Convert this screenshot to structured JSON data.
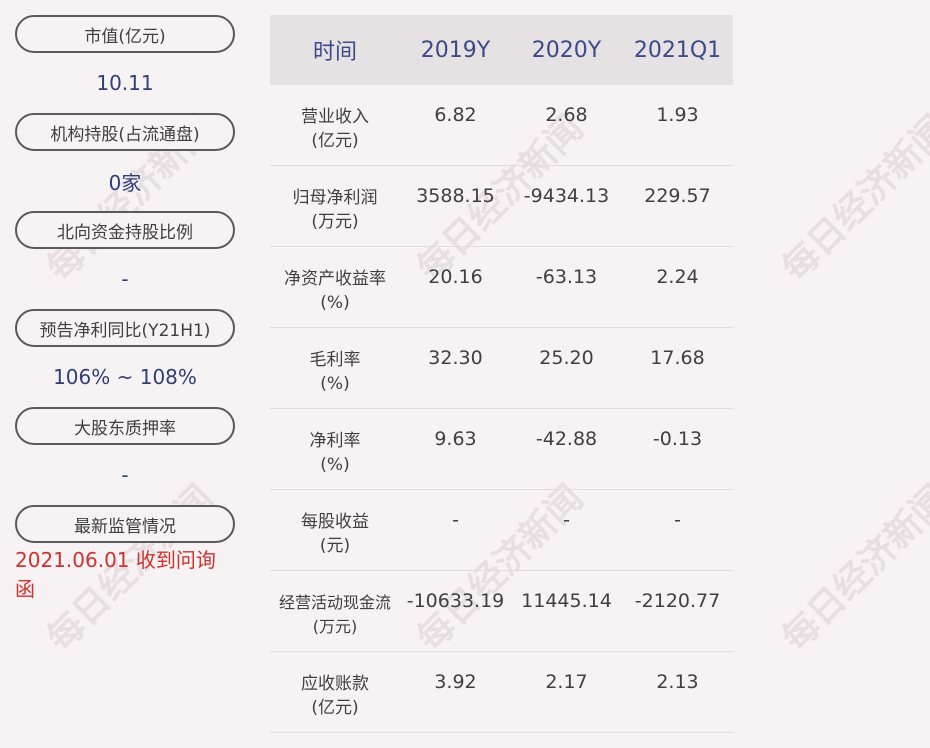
{
  "left": [
    {
      "label": "市值(亿元)",
      "value": "10.11",
      "alert": false
    },
    {
      "label": "机构持股(占流通盘)",
      "value": "0家",
      "alert": false
    },
    {
      "label": "北向资金持股比例",
      "value": "-",
      "alert": false
    },
    {
      "label": "预告净利同比(Y21H1)",
      "value": "106% ~ 108%",
      "alert": false
    },
    {
      "label": "大股东质押率",
      "value": "-",
      "alert": false
    },
    {
      "label": "最新监管情况",
      "value": "2021.06.01 收到问询函",
      "alert": true
    }
  ],
  "table": {
    "headers": [
      "时间",
      "2019Y",
      "2020Y",
      "2021Q1"
    ],
    "rows": [
      {
        "name": "营业收入",
        "unit": "(亿元)",
        "values": [
          "6.82",
          "2.68",
          "1.93"
        ]
      },
      {
        "name": "归母净利润",
        "unit": "(万元)",
        "values": [
          "3588.15",
          "-9434.13",
          "229.57"
        ]
      },
      {
        "name": "净资产收益率",
        "unit": "(%)",
        "values": [
          "20.16",
          "-63.13",
          "2.24"
        ]
      },
      {
        "name": "毛利率",
        "unit": "(%)",
        "values": [
          "32.30",
          "25.20",
          "17.68"
        ]
      },
      {
        "name": "净利率",
        "unit": "(%)",
        "values": [
          "9.63",
          "-42.88",
          "-0.13"
        ]
      },
      {
        "name": "每股收益",
        "unit": "(元)",
        "values": [
          "-",
          "-",
          "-"
        ]
      },
      {
        "name": "经营活动现金流",
        "unit": "(万元)",
        "values": [
          "-10633.19",
          "11445.14",
          "-2120.77"
        ]
      },
      {
        "name": "应收账款",
        "unit": "(亿元)",
        "values": [
          "3.92",
          "2.17",
          "2.13"
        ]
      }
    ]
  },
  "watermark": "每日经济新闻",
  "colors": {
    "background": "#f7f2f4",
    "value_blue": "#2f3f7a",
    "alert_red": "#d0312d",
    "header_bg": "#e6e1e3"
  }
}
